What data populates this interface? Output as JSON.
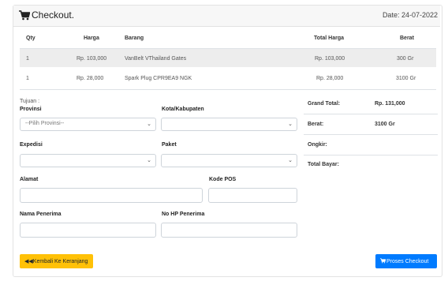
{
  "header": {
    "title": "Checkout.",
    "date": "Date: 24-07-2022"
  },
  "table": {
    "columns": [
      "Qty",
      "Harga",
      "Barang",
      "Total Harga",
      "Berat"
    ],
    "rows": [
      {
        "qty": "1",
        "harga": "Rp. 103,000",
        "barang": "VanBelt VThailand Gates",
        "total": "Rp. 103,000",
        "berat": "300 Gr"
      },
      {
        "qty": "1",
        "harga": "Rp. 28,000",
        "barang": "Spark Plug CPR9EA9 NGK",
        "total": "Rp. 28,000",
        "berat": "3100 Gr"
      }
    ]
  },
  "form": {
    "tujuan": "Tujuan :",
    "provinsi_label": "Provinsi",
    "provinsi_value": "--Pilih Provinsi--",
    "kota_label": "Kota/Kabupaten",
    "expedisi_label": "Expedisi",
    "paket_label": "Paket",
    "alamat_label": "Alamat",
    "kodepos_label": "Kode POS",
    "nama_label": "Nama Penerima",
    "hp_label": "No HP Penerima"
  },
  "summary": {
    "grand_total_label": "Grand Total:",
    "grand_total_value": "Rp. 131,000",
    "berat_label": "Berat:",
    "berat_value": "3100 Gr",
    "ongkir_label": "Ongkir:",
    "total_bayar_label": "Total Bayar:"
  },
  "buttons": {
    "back": "Kembali Ke Keranjang",
    "checkout": "Proses Checkout"
  },
  "colors": {
    "back_button": "#ffc107",
    "checkout_button": "#007bff",
    "row_highlight": "#ededed"
  },
  "icons": {
    "header": "cart-icon",
    "back": "double-left-arrow-icon",
    "checkout": "cart-icon"
  }
}
